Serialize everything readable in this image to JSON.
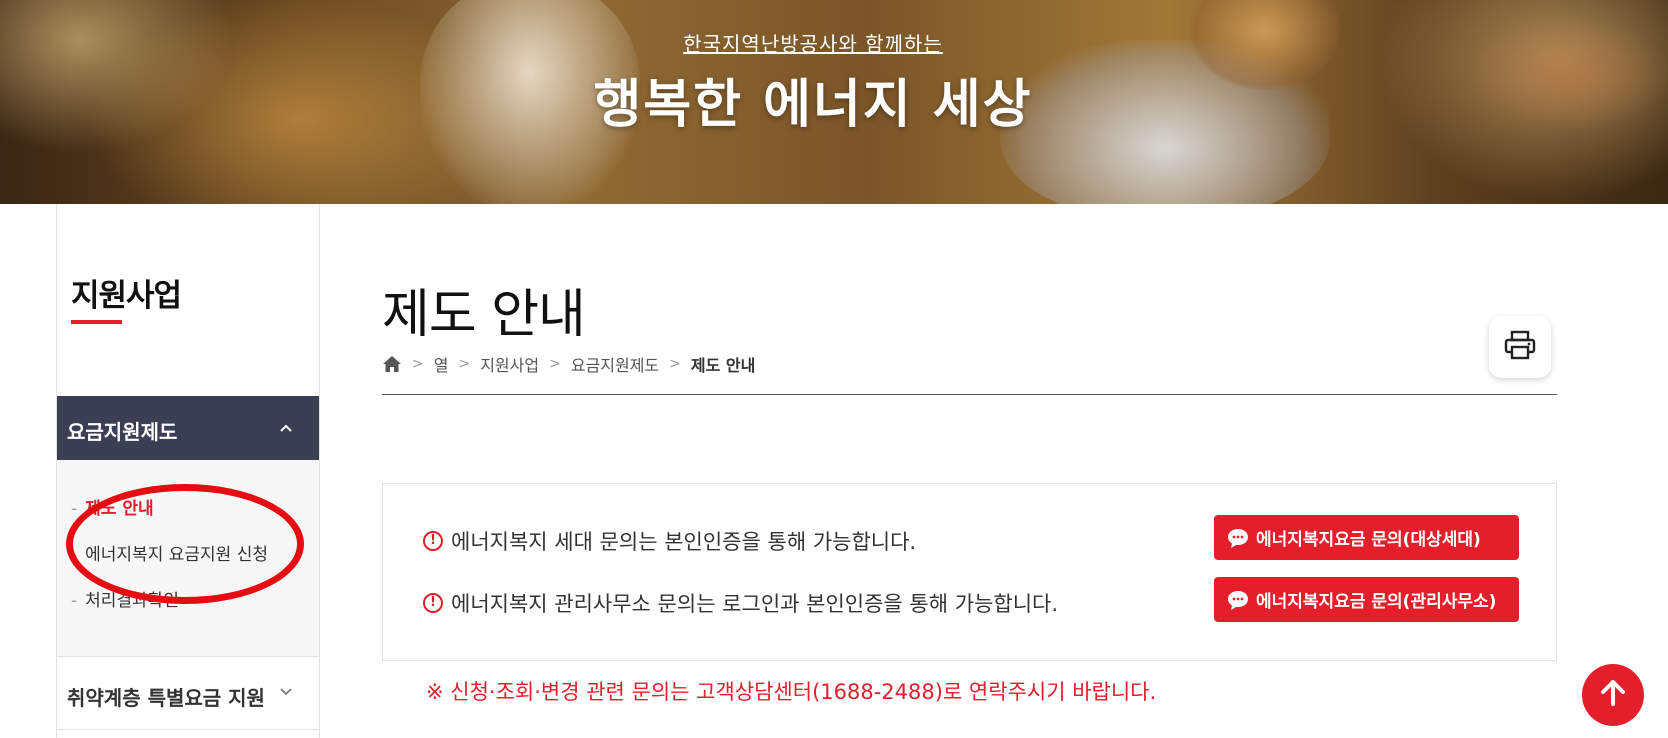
{
  "hero": {
    "subtitle": "한국지역난방공사와 함께하는",
    "title": "행복한 에너지 세상"
  },
  "sidebar": {
    "title": "지원사업",
    "active_section": {
      "label": "요금지원제도",
      "icon": "chevron-up-icon"
    },
    "sub_items": [
      {
        "label": "제도 안내",
        "active": true
      },
      {
        "label": "에너지복지 요금지원 신청",
        "active": false
      },
      {
        "label": "처리결과확인",
        "active": false
      }
    ],
    "section2": {
      "label": "취약계층 특별요금 지원",
      "icon": "chevron-down-icon"
    }
  },
  "main": {
    "title": "제도 안내",
    "breadcrumb": [
      "열",
      "지원사업",
      "요금지원제도",
      "제도 안내"
    ],
    "notices": [
      "에너지복지 세대 문의는 본인인증을 통해 가능합니다.",
      "에너지복지 관리사무소 문의는 로그인과 본인인증을 통해 가능합니다."
    ],
    "buttons": [
      "에너지복지요금 문의(대상세대)",
      "에너지복지요금 문의(관리사무소)"
    ],
    "footnote": "※ 신청·조회·변경 관련 문의는 고객상담센터(1688-2488)로 연락주시기 바랍니다."
  },
  "icons": {
    "print": "printer-icon",
    "home": "home-icon",
    "warning": "exclamation-circle-icon",
    "chat": "chat-bubble-icon",
    "top": "arrow-up-icon"
  },
  "colors": {
    "accent": "#e41e2b",
    "sidebar_active_bg": "#3b3f54",
    "annotation": "#e50d12"
  }
}
